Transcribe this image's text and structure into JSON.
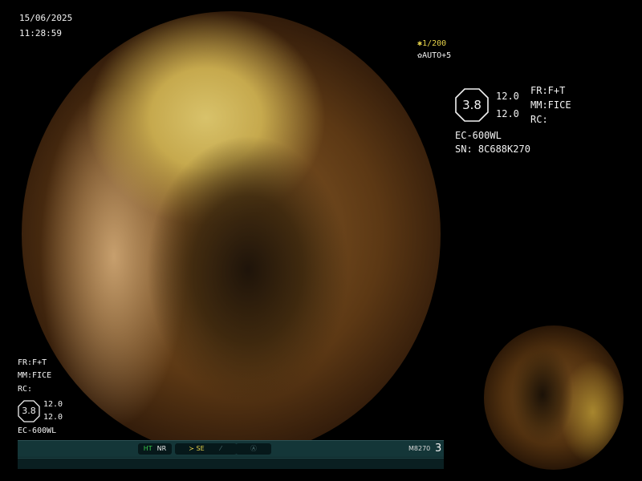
{
  "header": {
    "date": "15/06/2025",
    "time": "11:28:59"
  },
  "exposure": {
    "shutter_icon": "shutter-icon",
    "shutter": "1/200",
    "auto_icon": "iris-icon",
    "auto": "AUTO+5"
  },
  "right_panel": {
    "badge_value": "3.8",
    "value_top": "12.0",
    "value_bottom": "12.0",
    "fr": "FR:F+T",
    "mm": "MM:FICE",
    "rc": "RC:",
    "scope_model": "EC-600WL",
    "serial": "SN: 8C688K270"
  },
  "left_panel": {
    "fr": "FR:F+T",
    "mm": "MM:FICE",
    "rc": "RC:",
    "badge_value": "3.8",
    "value_top": "12.0",
    "value_bottom": "12.0",
    "scope_model": "EC-600WL"
  },
  "status_bar": {
    "ht": "HT",
    "nr": "NR",
    "se": "SE",
    "code": "M8270",
    "number": "3",
    "colors": {
      "ht": "#37c84a",
      "nr": "#e8e8e8",
      "se": "#e6d24a",
      "dim": "#4d6e70"
    }
  }
}
